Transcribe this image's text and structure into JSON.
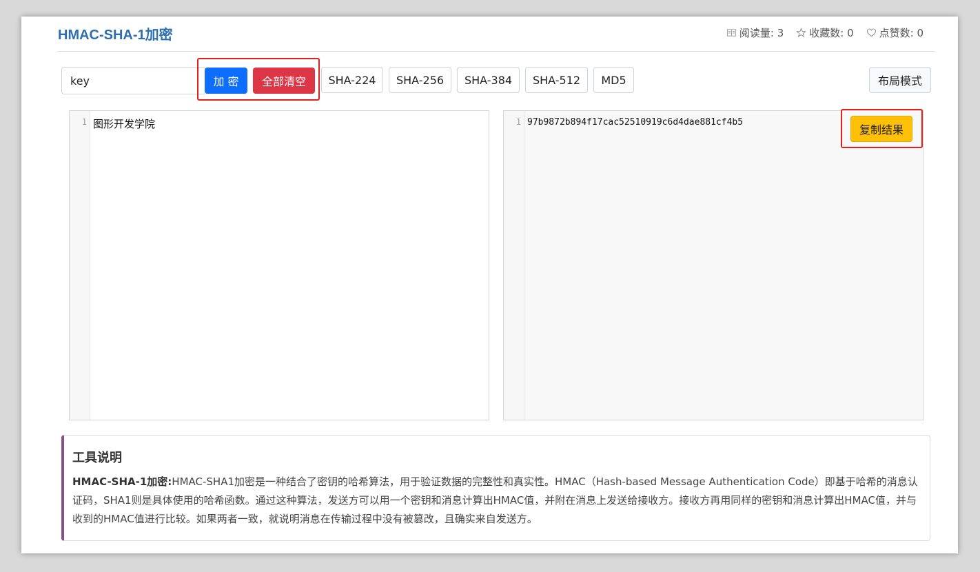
{
  "header": {
    "title": "HMAC-SHA-1加密",
    "stats": [
      {
        "icon": "read-count-icon",
        "label": "阅读量: 3"
      },
      {
        "icon": "star-icon",
        "label": "收藏数: 0"
      },
      {
        "icon": "heart-icon",
        "label": "点赞数: 0"
      }
    ]
  },
  "toolbar": {
    "key_value": "key",
    "encrypt_label": "加 密",
    "clear_label": "全部清空",
    "algorithms": [
      "SHA-224",
      "SHA-256",
      "SHA-384",
      "SHA-512",
      "MD5"
    ],
    "layout_label": "布局模式"
  },
  "input_editor": {
    "line_number": "1",
    "text": "图形开发学院"
  },
  "output_editor": {
    "line_number": "1",
    "text": "97b9872b894f17cac52510919c6d4dae881cf4b5",
    "copy_label": "复制结果"
  },
  "description": {
    "heading": "工具说明",
    "term": "HMAC-SHA-1加密:",
    "body": "HMAC-SHA1加密是一种结合了密钥的哈希算法，用于验证数据的完整性和真实性。HMAC（Hash-based Message Authentication Code）即基于哈希的消息认证码，SHA1则是具体使用的哈希函数。通过这种算法，发送方可以用一个密钥和消息计算出HMAC值，并附在消息上发送给接收方。接收方再用同样的密钥和消息计算出HMAC值，并与收到的HMAC值进行比较。如果两者一致，就说明消息在传输过程中没有被篡改，且确实来自发送方。"
  },
  "colors": {
    "title": "#2c6fb0",
    "primary": "#0d6efd",
    "danger": "#dc3545",
    "warning": "#ffc107",
    "highlight": "#e0211b",
    "accent_bar": "#8a4f87"
  }
}
